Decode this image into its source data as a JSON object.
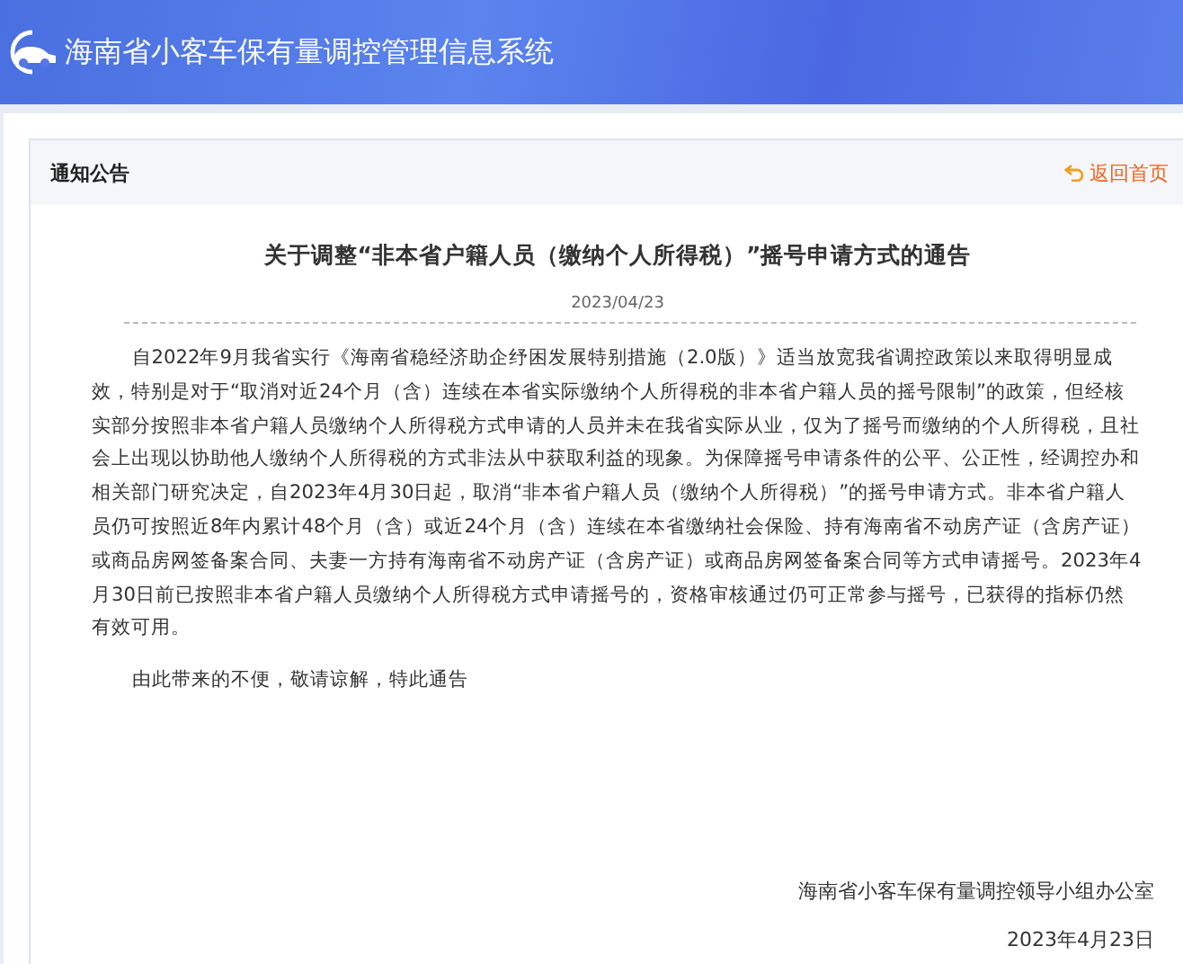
{
  "header": {
    "title": "海南省小客车保有量调控管理信息系统"
  },
  "panel": {
    "title": "通知公告",
    "back_link": "返回首页"
  },
  "notice": {
    "title": "关于调整“非本省户籍人员（缴纳个人所得税）”摇号申请方式的通告",
    "date": "2023/04/23",
    "paragraphs": [
      "自2022年9月我省实行《海南省稳经济助企纾困发展特别措施（2.0版）》适当放宽我省调控政策以来取得明显成效，特别是对于“取消对近24个月（含）连续在本省实际缴纳个人所得税的非本省户籍人员的摇号限制”的政策，但经核实部分按照非本省户籍人员缴纳个人所得税方式申请的人员并未在我省实际从业，仅为了摇号而缴纳的个人所得税，且社会上出现以协助他人缴纳个人所得税的方式非法从中获取利益的现象。为保障摇号申请条件的公平、公正性，经调控办和相关部门研究决定，自2023年4月30日起，取消“非本省户籍人员（缴纳个人所得税）”的摇号申请方式。非本省户籍人员仍可按照近8年内累计48个月（含）或近24个月（含）连续在本省缴纳社会保险、持有海南省不动房产证（含房产证）或商品房网签备案合同、夫妻一方持有海南省不动房产证（含房产证）或商品房网签备案合同等方式申请摇号。2023年4月30日前已按照非本省户籍人员缴纳个人所得税方式申请摇号的，资格审核通过仍可正常参与摇号，已获得的指标仍然有效可用。",
      "由此带来的不便，敬请谅解，特此通告"
    ],
    "signature": "海南省小客车保有量调控领导小组办公室",
    "signed_date": "2023年4月23日"
  }
}
